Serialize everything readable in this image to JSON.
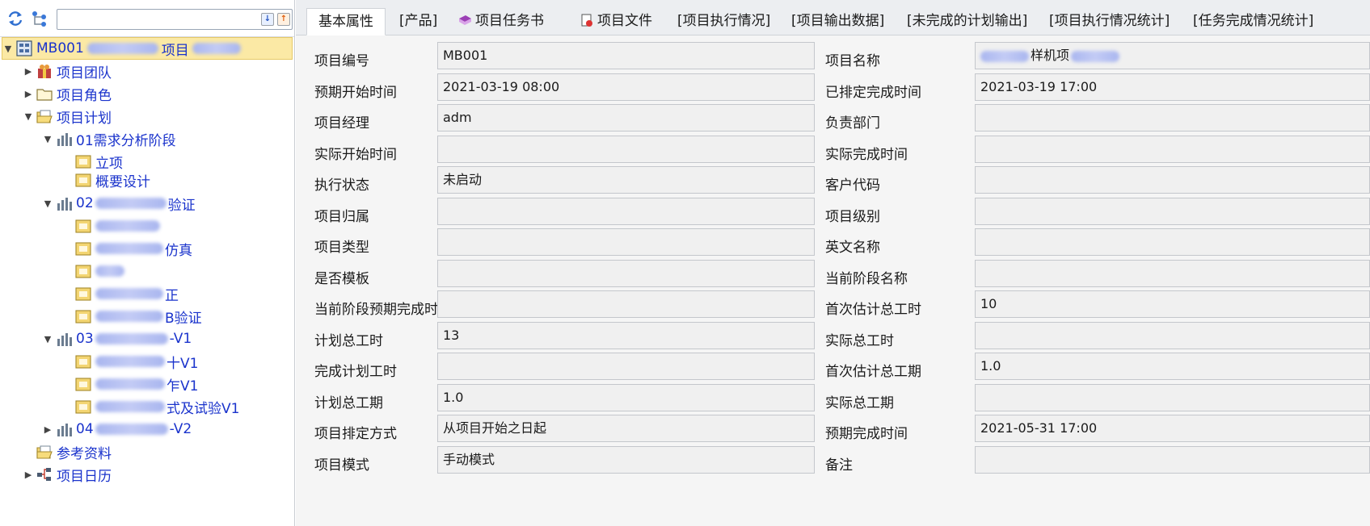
{
  "tree": {
    "root": "MB001",
    "root_suffix": "项目",
    "team": "项目团队",
    "roles": "项目角色",
    "plan": "项目计划",
    "phase1": "01需求分析阶段",
    "phase1_items": [
      "立项",
      "概要设计"
    ],
    "phase2_prefix": "02",
    "phase2_suffix": "验证",
    "phase2_items_suffix": [
      "",
      "仿真",
      "",
      "正",
      "B验证"
    ],
    "phase3_prefix": "03",
    "phase3_suffix": "-V1",
    "phase3_items_suffix": [
      "十V1",
      "乍V1",
      "式及试验V1"
    ],
    "phase4_prefix": "04",
    "phase4_suffix": "-V2",
    "reference": "参考资料",
    "calendar": "项目日历"
  },
  "tabs": [
    "基本属性",
    "[产品]",
    "项目任务书",
    "项目文件",
    "[项目执行情况]",
    "[项目输出数据]",
    "[未完成的计划输出]",
    "[项目执行情况统计]",
    "[任务完成情况统计]"
  ],
  "form": {
    "rows": [
      {
        "l1": "项目编号",
        "v1": "MB001",
        "l2": "项目名称",
        "v2": "样机项"
      },
      {
        "l1": "预期开始时间",
        "v1": "2021-03-19 08:00",
        "l2": "已排定完成时间",
        "v2": "2021-03-19 17:00"
      },
      {
        "l1": "项目经理",
        "v1": "adm",
        "l2": "负责部门",
        "v2": ""
      },
      {
        "l1": "实际开始时间",
        "v1": "",
        "l2": "实际完成时间",
        "v2": ""
      },
      {
        "l1": "执行状态",
        "v1": "未启动",
        "l2": "客户代码",
        "v2": ""
      },
      {
        "l1": "项目归属",
        "v1": "",
        "l2": "项目级别",
        "v2": ""
      },
      {
        "l1": "项目类型",
        "v1": "",
        "l2": "英文名称",
        "v2": ""
      },
      {
        "l1": "是否模板",
        "v1": "",
        "l2": "当前阶段名称",
        "v2": ""
      },
      {
        "l1": "当前阶段预期完成时间",
        "v1": "",
        "l2": "首次估计总工时",
        "v2": "10"
      },
      {
        "l1": "计划总工时",
        "v1": "13",
        "l2": "实际总工时",
        "v2": ""
      },
      {
        "l1": "完成计划工时",
        "v1": "",
        "l2": "首次估计总工期",
        "v2": "1.0"
      },
      {
        "l1": "计划总工期",
        "v1": "1.0",
        "l2": "实际总工期",
        "v2": ""
      },
      {
        "l1": "项目排定方式",
        "v1": "从项目开始之日起",
        "l2": "预期完成时间",
        "v2": "2021-05-31 17:00"
      },
      {
        "l1": "项目模式",
        "v1": "手动模式",
        "l2": "备注",
        "v2": ""
      }
    ]
  },
  "colors": {
    "link": "#1a33cc",
    "selected_bg": "#fbe9a5",
    "tab_bar": "#eceef1",
    "field_bg": "#f0f0f0"
  }
}
